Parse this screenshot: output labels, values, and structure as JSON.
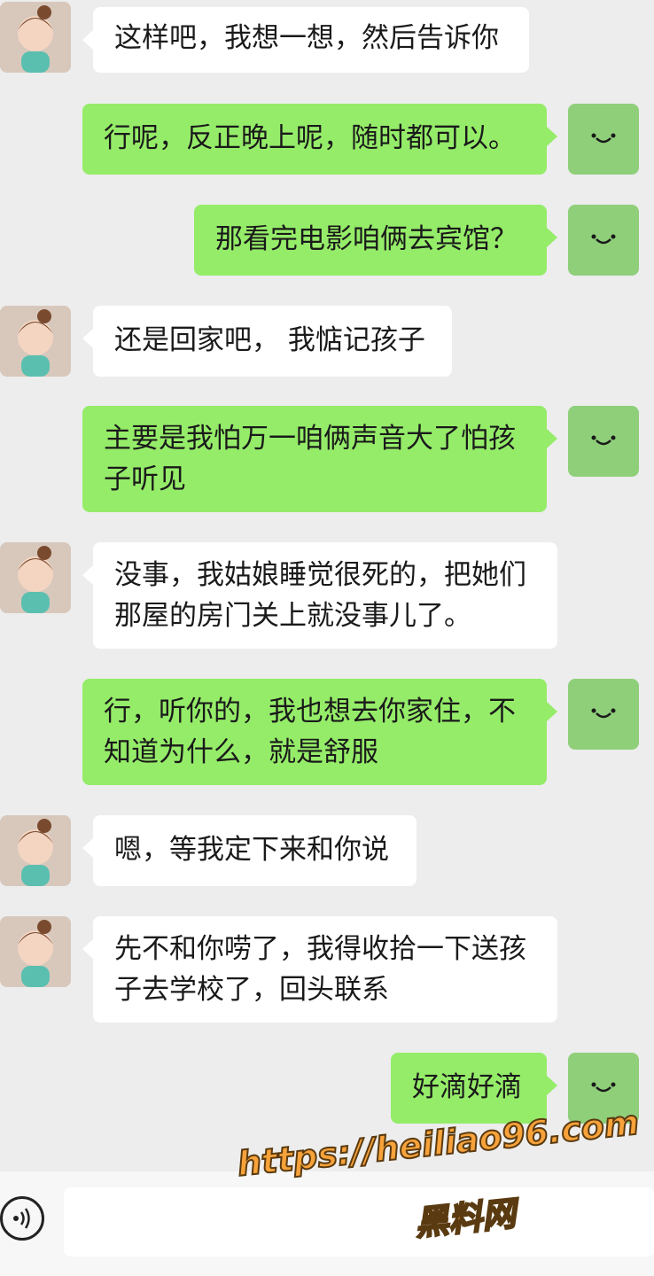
{
  "messages": [
    {
      "side": "left",
      "text": "这样吧，我想一想，然后告诉你"
    },
    {
      "side": "right",
      "text": "行呢，反正晚上呢，随时都可以。"
    },
    {
      "side": "right",
      "text": "那看完电影咱俩去宾馆？"
    },
    {
      "side": "left",
      "text": "还是回家吧， 我惦记孩子"
    },
    {
      "side": "right",
      "text": "主要是我怕万一咱俩声音大了怕孩\n子听见"
    },
    {
      "side": "left",
      "text": "没事，我姑娘睡觉很死的，把她们\n那屋的房门关上就没事儿了。"
    },
    {
      "side": "right",
      "text": "行，听你的，我也想去你家住，不\n知道为什么，就是舒服"
    },
    {
      "side": "left",
      "text": "嗯，等我定下来和你说"
    },
    {
      "side": "left",
      "text": "先不和你唠了，我得收拾一下送孩\n子去学校了，回头联系"
    },
    {
      "side": "right",
      "text": "好滴好滴"
    }
  ],
  "input_bar": {
    "voice_icon": "voice-icon"
  },
  "watermark": {
    "url": "https://heiliao96.com",
    "name": "黑料网"
  },
  "colors": {
    "background": "#ededed",
    "bubble_right": "#95ec69",
    "bubble_left": "#ffffff"
  }
}
